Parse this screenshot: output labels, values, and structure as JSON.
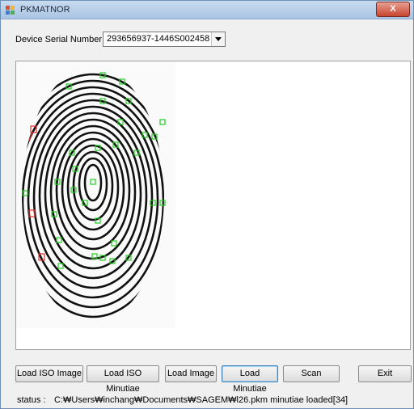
{
  "window": {
    "title": "PKMATNOR",
    "close_glyph": "X"
  },
  "device": {
    "label": "Device Serial Number :",
    "value": "293656937-1446S002458"
  },
  "toolbar": {
    "load_iso_image": "Load ISO Image",
    "load_iso_minutiae": "Load ISO Minutiae",
    "load_image": "Load Image",
    "load_minutiae": "Load Minutiae",
    "scan": "Scan",
    "exit": "Exit"
  },
  "status": {
    "label": "status :",
    "text": "C:₩Users₩inchang₩Documents₩SAGEM₩l26.pkm minutiae loaded[34]"
  },
  "fingerprint": {
    "minutiae_count": 34,
    "marker_color_ridge_end": "#22cc22",
    "marker_color_bifurcation": "#e03030"
  },
  "icons": {
    "app": "fingerprint-app-icon",
    "close": "close-icon",
    "dropdown": "chevron-down-icon"
  }
}
